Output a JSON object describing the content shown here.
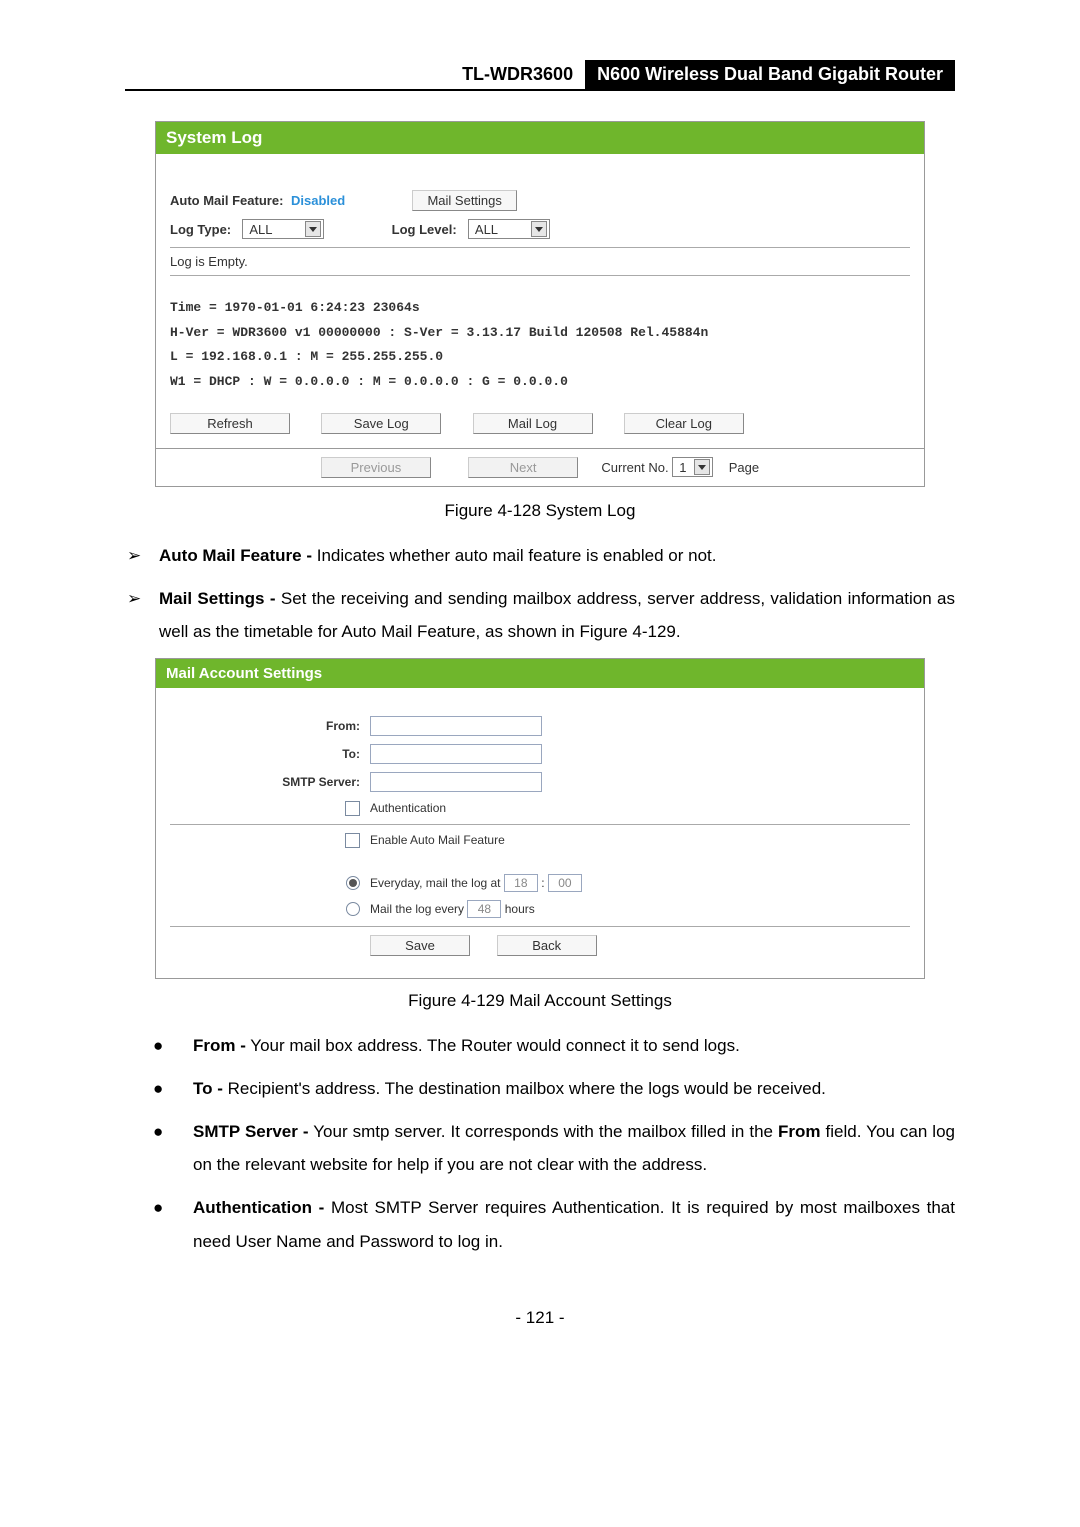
{
  "header": {
    "model": "TL-WDR3600",
    "desc": "N600 Wireless Dual Band Gigabit Router"
  },
  "syslog": {
    "title": "System Log",
    "auto_mail_label": "Auto Mail Feature:",
    "auto_mail_value": "Disabled",
    "mail_settings_btn": "Mail Settings",
    "log_type_label": "Log Type:",
    "log_type_value": "ALL",
    "log_level_label": "Log Level:",
    "log_level_value": "ALL",
    "empty_text": "Log is Empty.",
    "info_lines": {
      "l1": "Time = 1970-01-01 6:24:23 23064s",
      "l2": "H-Ver = WDR3600 v1 00000000 : S-Ver = 3.13.17 Build 120508 Rel.45884n",
      "l3": "L = 192.168.0.1 : M = 255.255.255.0",
      "l4": "W1 = DHCP : W = 0.0.0.0 : M = 0.0.0.0 : G = 0.0.0.0"
    },
    "btns": {
      "refresh": "Refresh",
      "save": "Save Log",
      "mail": "Mail Log",
      "clear": "Clear Log"
    },
    "pager": {
      "prev": "Previous",
      "next": "Next",
      "curno_label": "Current No.",
      "curno_value": "1",
      "page_label": "Page"
    }
  },
  "caption1": "Figure 4-128 System Log",
  "feature_list": {
    "i1_label": "Auto Mail Feature -",
    "i1_text": " Indicates whether auto mail feature is enabled or not.",
    "i2_label": "Mail Settings -",
    "i2_text": " Set the receiving and sending mailbox address, server address, validation information as well as the timetable for Auto Mail Feature, as shown in Figure 4-129."
  },
  "mail": {
    "title": "Mail Account Settings",
    "from": "From:",
    "to": "To:",
    "smtp": "SMTP Server:",
    "auth": "Authentication",
    "enable": "Enable Auto Mail Feature",
    "everyday_prefix": "Everyday, mail the log at",
    "everyday_hour": "18",
    "colon": ":",
    "everyday_min": "00",
    "every_prefix": "Mail the log every",
    "every_val": "48",
    "every_suffix": "hours",
    "save": "Save",
    "back": "Back"
  },
  "caption2": "Figure 4-129 Mail Account Settings",
  "fields": {
    "f1_label": "From -",
    "f1_text": " Your mail box address. The Router would connect it to send logs.",
    "f2_label": "To -",
    "f2_text": " Recipient's address. The destination mailbox where the logs would be received.",
    "f3_label": "SMTP Server -",
    "f3_text_a": " Your smtp server. It corresponds with the mailbox filled in the ",
    "f3_bold": "From",
    "f3_text_b": " field. You can log on the relevant website for help if you are not clear with the address.",
    "f4_label": "Authentication -",
    "f4_text": " Most SMTP Server requires Authentication. It is required by most mailboxes that need User Name and Password to log in."
  },
  "pagenum": "- 121 -"
}
